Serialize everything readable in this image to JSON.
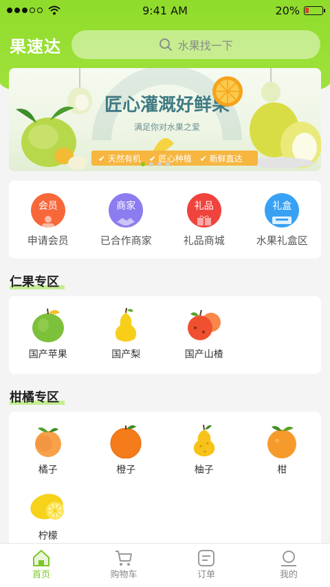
{
  "status": {
    "time": "9:41 AM",
    "battery": "20%"
  },
  "header": {
    "brand": "果速达",
    "search_placeholder": "水果找一下"
  },
  "banner": {
    "title": "匠心灌溉好鲜果",
    "subtitle": "满足你对水果之爱",
    "tags": [
      "天然有机",
      "匠心种植",
      "新鲜直达"
    ],
    "active_slide": 1,
    "slide_count": 4
  },
  "quick_menu": [
    {
      "badge": "会员",
      "label": "申请会员",
      "color": "#f7673a",
      "icon": "member-icon"
    },
    {
      "badge": "商家",
      "label": "已合作商家",
      "color": "#8b7cf0",
      "icon": "handshake-icon"
    },
    {
      "badge": "礼品",
      "label": "礼品商城",
      "color": "#f0433e",
      "icon": "gift-icon"
    },
    {
      "badge": "礼盒",
      "label": "水果礼盒区",
      "color": "#39a1f4",
      "icon": "giftbox-icon"
    }
  ],
  "sections": [
    {
      "title": "仁果专区",
      "items": [
        "国产苹果",
        "国产梨",
        "国产山楂"
      ]
    },
    {
      "title": "柑橘专区",
      "items": [
        "橘子",
        "橙子",
        "柚子",
        "柑",
        "柠檬"
      ]
    }
  ],
  "tabbar": [
    {
      "label": "首页",
      "icon": "home-icon",
      "active": true
    },
    {
      "label": "购物车",
      "icon": "cart-icon",
      "active": false
    },
    {
      "label": "订单",
      "icon": "order-icon",
      "active": false
    },
    {
      "label": "我的",
      "icon": "profile-icon",
      "active": false
    }
  ],
  "colors": {
    "accent": "#7cc726",
    "header_green": "#9be03a"
  }
}
